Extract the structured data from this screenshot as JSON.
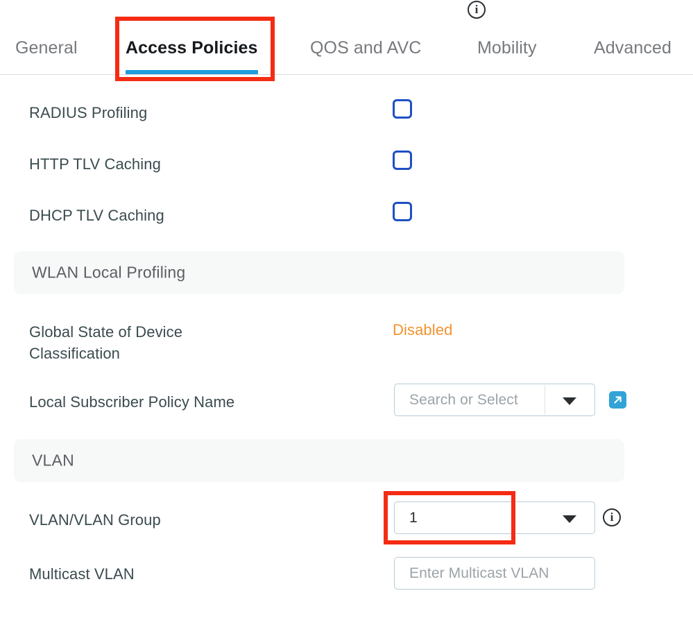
{
  "tabs": [
    {
      "id": "general",
      "label": "General",
      "active": false
    },
    {
      "id": "access",
      "label": "Access Policies",
      "active": true
    },
    {
      "id": "qos",
      "label": "QOS and AVC",
      "active": false
    },
    {
      "id": "mobility",
      "label": "Mobility",
      "active": false
    },
    {
      "id": "advanced",
      "label": "Advanced",
      "active": false
    }
  ],
  "toggles": [
    {
      "label": "RADIUS Profiling",
      "checked": false
    },
    {
      "label": "HTTP TLV Caching",
      "checked": false
    },
    {
      "label": "DHCP TLV Caching",
      "checked": false
    }
  ],
  "sections": {
    "wlan_local_profiling": {
      "title": "WLAN Local Profiling"
    },
    "vlan": {
      "title": "VLAN"
    }
  },
  "global_state": {
    "label": "Global State of Device\nClassification",
    "value": "Disabled",
    "info_icon": "info-icon"
  },
  "local_subscriber_policy": {
    "label": "Local Subscriber Policy Name",
    "value": "",
    "placeholder": "Search or Select",
    "caret_icon": "chevron-down-icon",
    "external_link_icon": "external-link-icon"
  },
  "vlan_group": {
    "label": "VLAN/VLAN Group",
    "value": "1",
    "caret_icon": "chevron-down-icon",
    "info_icon": "info-icon"
  },
  "multicast_vlan": {
    "label": "Multicast VLAN",
    "value": "",
    "placeholder": "Enter Multicast VLAN"
  },
  "annotations": [
    {
      "id": "annot-tab",
      "target": "Access Policies tab",
      "color": "#f42c14"
    },
    {
      "id": "annot-vlan",
      "target": "VLAN/VLAN Group value",
      "color": "#f42c14"
    }
  ],
  "colors": {
    "accent_blue": "#1d9cdc",
    "checkbox_blue": "#1f4fc4",
    "status_orange": "#f2932e",
    "annotation_red": "#f42c14",
    "label_text": "#3b4b4f",
    "tab_inactive": "#76797d",
    "band_bg": "#f7f8f8",
    "field_border": "#b7ccd6",
    "link_button": "#31a3d6"
  }
}
